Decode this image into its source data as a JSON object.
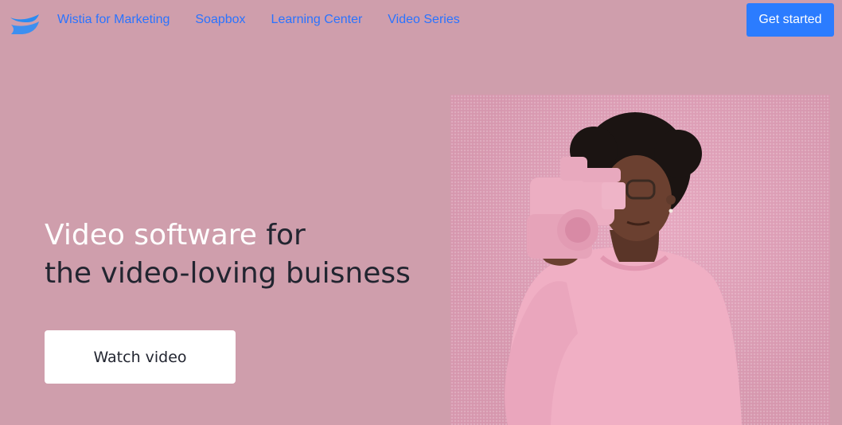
{
  "nav": {
    "logo_icon": "wistia-logo-icon",
    "links": [
      "Wistia for Marketing",
      "Soapbox",
      "Learning Center",
      "Video Series"
    ],
    "cta_label": "Get started"
  },
  "hero": {
    "title_strong": "Video software",
    "title_rest_line1": " for",
    "title_line2": "the video-loving buisness",
    "watch_label": "Watch video",
    "image_subject": "person-with-camera-image"
  },
  "colors": {
    "background": "#cf9eac",
    "link": "#2a73ff",
    "cta": "#2b7cff",
    "text_dark": "#222530",
    "text_light": "#ffffff"
  }
}
